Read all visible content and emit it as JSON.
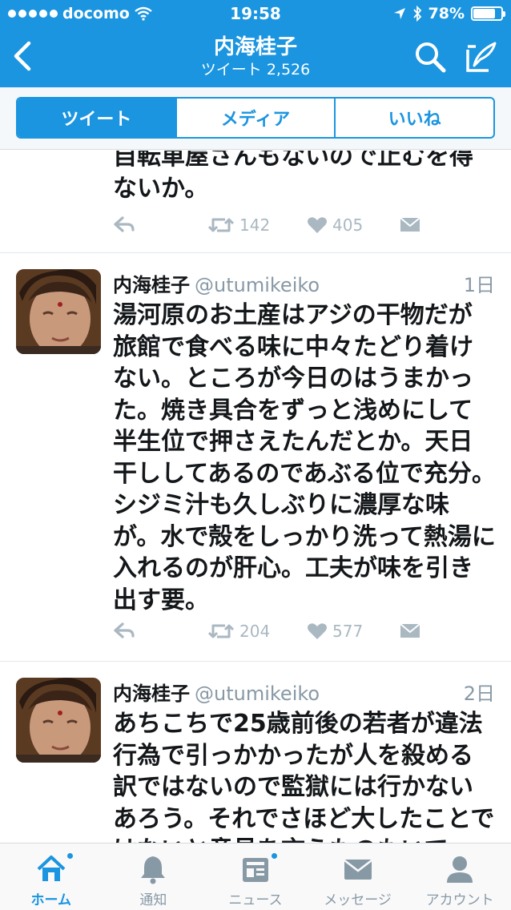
{
  "status_bar": {
    "carrier": "docomo",
    "time": "19:58",
    "battery": "78%",
    "battery_level": 0.78
  },
  "header": {
    "title": "内海桂子",
    "subtitle": "ツイート 2,526"
  },
  "tabs_top": [
    {
      "label": "ツイート",
      "active": true
    },
    {
      "label": "メディア",
      "active": false
    },
    {
      "label": "いいね",
      "active": false
    }
  ],
  "tweets": [
    {
      "text": "自転車屋さんもないので止むを得ないか。",
      "retweets": "142",
      "likes": "405"
    },
    {
      "name": "内海桂子",
      "handle": "@utumikeiko",
      "time": "1日",
      "text": "湯河原のお土産はアジの干物だが旅館で食べる味に中々たどり着けない。ところが今日のはうまかった。焼き具合をずっと浅めにして半生位で押さえたんだとか。天日干ししてあるのであぶる位で充分。シジミ汁も久しぶりに濃厚な味が。水で殻をしっかり洗って熱湯に入れるのが肝心。工夫が味を引き出す要。",
      "retweets": "204",
      "likes": "577"
    },
    {
      "name": "内海桂子",
      "handle": "@utumikeiko",
      "time": "2日",
      "text": "あちこちで25歳前後の若者が違法行為で引っかかったが人を殺める訳ではないので監獄には行かないあろう。それでさほど大したことではないと意見を言うものもいて"
    }
  ],
  "tab_bar": [
    {
      "label": "ホーム",
      "icon": "home-icon",
      "active": true,
      "badge": true
    },
    {
      "label": "通知",
      "icon": "bell-icon",
      "active": false,
      "badge": false
    },
    {
      "label": "ニュース",
      "icon": "news-icon",
      "active": false,
      "badge": true
    },
    {
      "label": "メッセージ",
      "icon": "envelope-icon",
      "active": false,
      "badge": false
    },
    {
      "label": "アカウント",
      "icon": "person-icon",
      "active": false,
      "badge": false
    }
  ],
  "colors": {
    "accent": "#1b95e0",
    "muted": "#8899a6",
    "action": "#aab8c2"
  }
}
